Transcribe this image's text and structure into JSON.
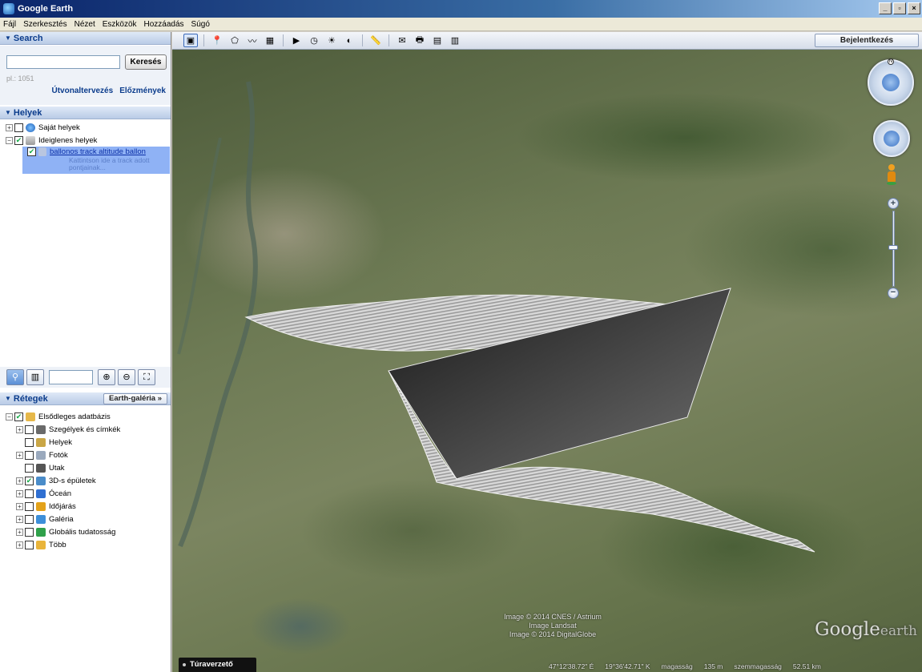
{
  "window": {
    "title": "Google Earth",
    "controls": [
      "_",
      "▫",
      "×"
    ]
  },
  "menu": [
    "Fájl",
    "Szerkesztés",
    "Nézet",
    "Eszközök",
    "Hozzáadás",
    "Súgó"
  ],
  "search": {
    "header": "Search",
    "input_value": "",
    "button": "Keresés",
    "hint": "pl.: 1051",
    "links": [
      "Útvonaltervezés",
      "Előzmények"
    ]
  },
  "places": {
    "header": "Helyek",
    "items": [
      {
        "label": "Saját helyek",
        "checked": false,
        "icon": "globe-icon"
      },
      {
        "label": "Ideiglenes helyek",
        "checked": true,
        "icon": "folder-icon"
      }
    ],
    "selected": {
      "title": "ballonos track altitude ballon",
      "desc": [
        "Kattintson ide a track adott",
        "pontjainak..."
      ]
    }
  },
  "layer_toolbar": {
    "buttons": [
      "⊕",
      "⊖",
      "⛶"
    ]
  },
  "layers": {
    "header": "Rétegek",
    "gallery_button": "Earth-galéria »",
    "items": [
      {
        "label": "Elsődleges adatbázis",
        "checked": true,
        "expander": "⊟",
        "color": "#e6b84a"
      },
      {
        "label": "Szegélyek és címkék",
        "checked": false,
        "expander": "⊞",
        "color": "#6a6a6a"
      },
      {
        "label": "Helyek",
        "checked": false,
        "expander": "",
        "color": "#c9a646"
      },
      {
        "label": "Fotók",
        "checked": false,
        "expander": "⊞",
        "color": "#9aa9bd"
      },
      {
        "label": "Utak",
        "checked": false,
        "expander": "",
        "color": "#555555"
      },
      {
        "label": "3D-s épületek",
        "checked": true,
        "expander": "⊞",
        "color": "#4a8cc9"
      },
      {
        "label": "Óceán",
        "checked": false,
        "expander": "⊞",
        "color": "#2f6fd1"
      },
      {
        "label": "Időjárás",
        "checked": false,
        "expander": "⊞",
        "color": "#e3a21a"
      },
      {
        "label": "Galéria",
        "checked": false,
        "expander": "⊞",
        "color": "#3d8fd9"
      },
      {
        "label": "Globális tudatosság",
        "checked": false,
        "expander": "⊞",
        "color": "#2fa04a"
      },
      {
        "label": "Több",
        "checked": false,
        "expander": "⊞",
        "color": "#e9b43a"
      }
    ]
  },
  "toolbar": {
    "buttons": [
      {
        "name": "sidebar-toggle-icon",
        "glyph": "▣"
      },
      {
        "name": "placemark-icon",
        "glyph": "📍"
      },
      {
        "name": "polygon-icon",
        "glyph": "⬠"
      },
      {
        "name": "path-icon",
        "glyph": "〰"
      },
      {
        "name": "overlay-icon",
        "glyph": "▦"
      },
      {
        "name": "record-tour-icon",
        "glyph": "▶"
      },
      {
        "name": "history-icon",
        "glyph": "◷"
      },
      {
        "name": "sun-icon",
        "glyph": "☀"
      },
      {
        "name": "planets-icon",
        "glyph": "◐"
      },
      {
        "name": "ruler-icon",
        "glyph": "📏"
      },
      {
        "name": "email-icon",
        "glyph": "✉"
      },
      {
        "name": "print-icon",
        "glyph": "🖶"
      },
      {
        "name": "save-image-icon",
        "glyph": "▤"
      },
      {
        "name": "maps-icon",
        "glyph": "▥"
      }
    ],
    "signin": "Bejelentkezés"
  },
  "map": {
    "attribution": [
      "Image © 2014 CNES / Astrium",
      "Image Landsat",
      "Image © 2014 DigitalGlobe"
    ],
    "logo_main": "Google",
    "logo_sub": "earth",
    "tour_button": "Túraverzető",
    "status": [
      "47°12'38.72\" É",
      "19°36'42.71\" K",
      "magasság",
      "135 m",
      "szemmagasság",
      "52.51 km"
    ]
  }
}
